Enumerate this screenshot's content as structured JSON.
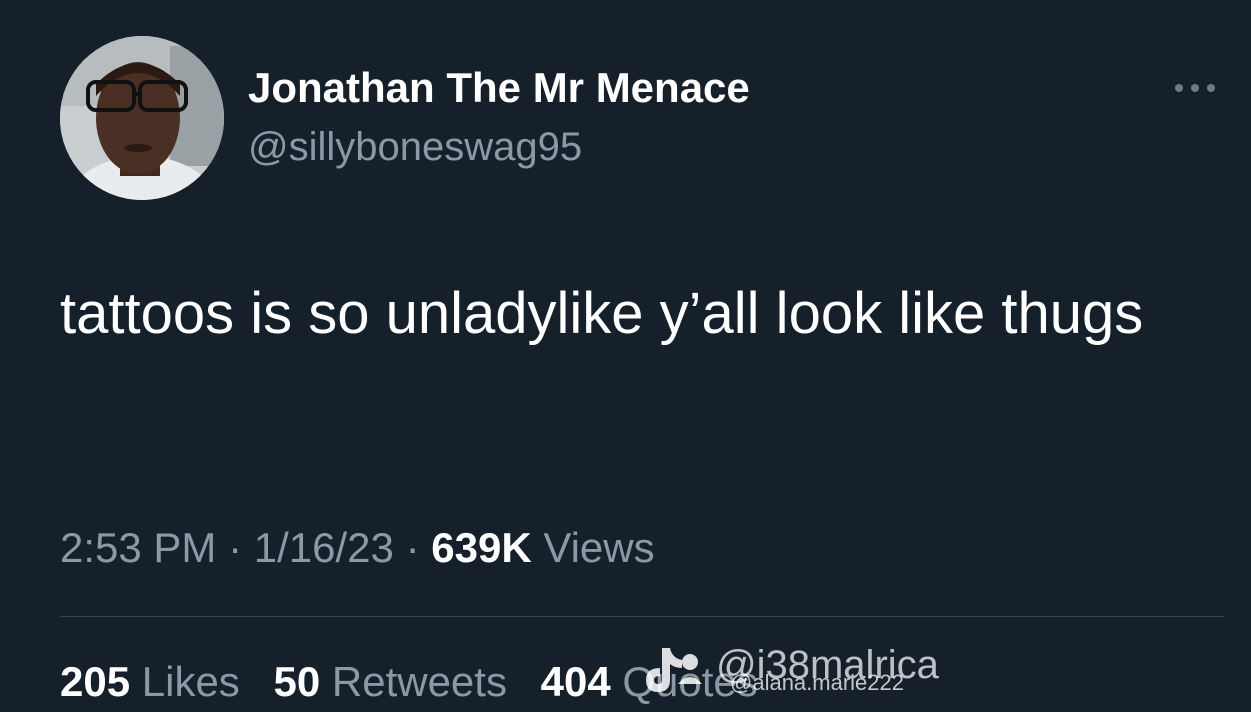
{
  "tweet": {
    "display_name": "Jonathan The Mr Menace",
    "handle": "@sillyboneswag95",
    "more_icon": "ellipsis-icon",
    "text": "tattoos is so unladylike y’all look like thugs",
    "time": "2:53 PM",
    "date": "1/16/23",
    "separator": "·",
    "views_count": "639K",
    "views_label": "Views",
    "likes_count": "205",
    "likes_label": "Likes",
    "retweets_count": "50",
    "retweets_label": "Retweets",
    "quotes_count": "404",
    "quotes_label": "Quotes"
  },
  "watermark": {
    "icon": "tiktok-logo-icon",
    "main_text": "@i38malrica",
    "sub_text": "@alana.marie222"
  },
  "colors": {
    "background": "#15202b",
    "primary_text": "#ffffff",
    "secondary_text": "#8b98a5",
    "divider": "#38444d"
  }
}
